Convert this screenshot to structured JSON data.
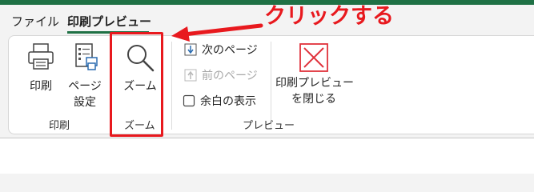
{
  "tabs": {
    "file": "ファイル",
    "print_preview": "印刷プレビュー"
  },
  "ribbon": {
    "print": {
      "button_label": "印刷",
      "page_setup_line1": "ページ",
      "page_setup_line2": "設定",
      "group_label": "印刷"
    },
    "zoom": {
      "button_label": "ズーム",
      "group_label": "ズーム"
    },
    "preview": {
      "next_page": "次のページ",
      "prev_page": "前のページ",
      "show_margins": "余白の表示",
      "close_line1": "印刷プレビュー",
      "close_line2": "を閉じる",
      "group_label": "プレビュー"
    }
  },
  "annotation": {
    "text": "クリックする"
  },
  "colors": {
    "accent": "#1f7145",
    "annotation": "#e8191e",
    "close_icon": "#e0313b"
  }
}
